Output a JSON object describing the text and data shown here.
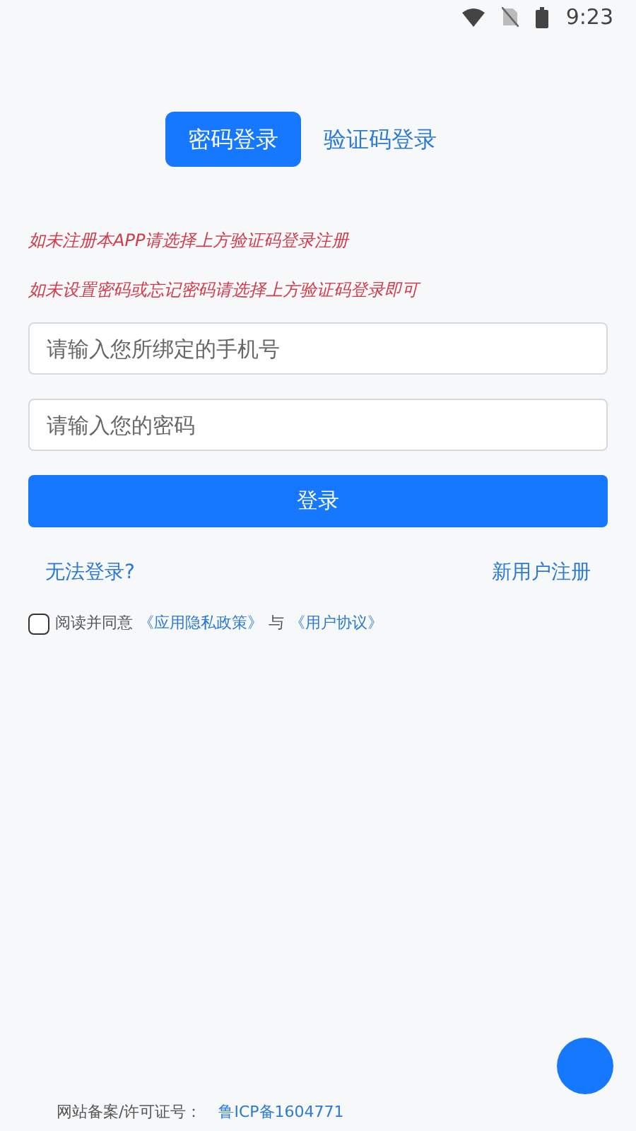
{
  "status_bar": {
    "time": "9:23"
  },
  "tabs": [
    {
      "label": "密码登录",
      "selected": true
    },
    {
      "label": "验证码登录",
      "selected": false
    }
  ],
  "notices": [
    "如未注册本APP请选择上方验证码登录注册",
    "如未设置密码或忘记密码请选择上方验证码登录即可"
  ],
  "fields": [
    {
      "placeholder": "请输入您所绑定的手机号"
    },
    {
      "placeholder": "请输入您的密码"
    }
  ],
  "login_button": "登录",
  "links": {
    "forgot": "无法登录?",
    "register": "新用户注册"
  },
  "agreement": {
    "checked": false,
    "prefix": "阅读并同意",
    "privacy": "《应用隐私政策》",
    "conjunction": "与",
    "terms": "《用户协议》"
  },
  "footer": {
    "label": "网站备案/许可证号：",
    "icp": "鲁ICP备1604771"
  }
}
